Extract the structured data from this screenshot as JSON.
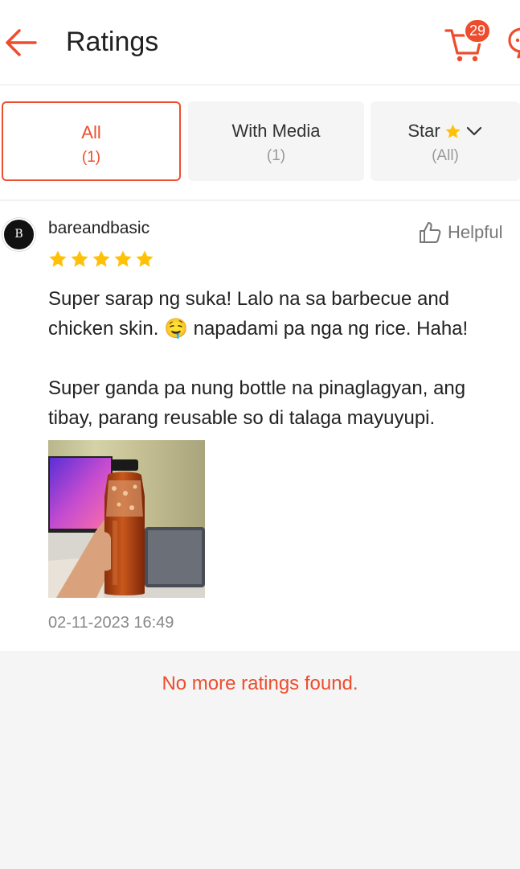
{
  "header": {
    "title": "Ratings",
    "cart_count": "29",
    "accent": "#ee4d2d"
  },
  "filters": [
    {
      "label": "All",
      "count": "(1)"
    },
    {
      "label": "With Media",
      "count": "(1)"
    },
    {
      "label": "Star",
      "count": "(All)"
    }
  ],
  "review": {
    "avatar_text": "B",
    "username": "bareandbasic",
    "rating": 5,
    "helpful_label": "Helpful",
    "paragraph_1": "Super sarap ng suka! Lalo na sa barbecue and chicken skin. 🤤 napadami pa nga ng rice. Haha!",
    "paragraph_2": "Super ganda pa nung bottle na pinaglagyan, ang tibay, parang reusable so di talaga mayuyupi.",
    "timestamp": "02-11-2023 16:49"
  },
  "footer": {
    "no_more_text": "No more ratings found."
  },
  "icons": [
    "back-arrow-icon",
    "cart-icon",
    "chat-icon",
    "star-icon",
    "chevron-down-icon",
    "thumbs-up-icon"
  ]
}
